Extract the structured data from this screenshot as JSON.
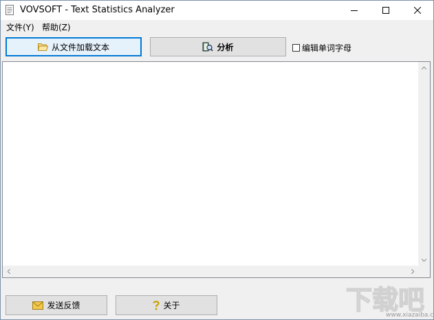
{
  "window": {
    "title": "VOVSOFT - Text Statistics Analyzer"
  },
  "menu": {
    "items": [
      "文件(Y)",
      "帮助(Z)"
    ]
  },
  "toolbar": {
    "load_label": "从文件加载文本",
    "analyze_label": "分析",
    "checkbox_label": "编辑单词字母",
    "checkbox_checked": false
  },
  "editor": {
    "text": ""
  },
  "footer": {
    "feedback_label": "发送反馈",
    "about_label": "关于"
  },
  "watermark": {
    "text": "下载吧",
    "subtext": "www.xiazaiba.com"
  },
  "colors": {
    "focus_accent": "#0078d7",
    "button_bg": "#e1e1e1",
    "window_bg": "#f0f0f0"
  }
}
